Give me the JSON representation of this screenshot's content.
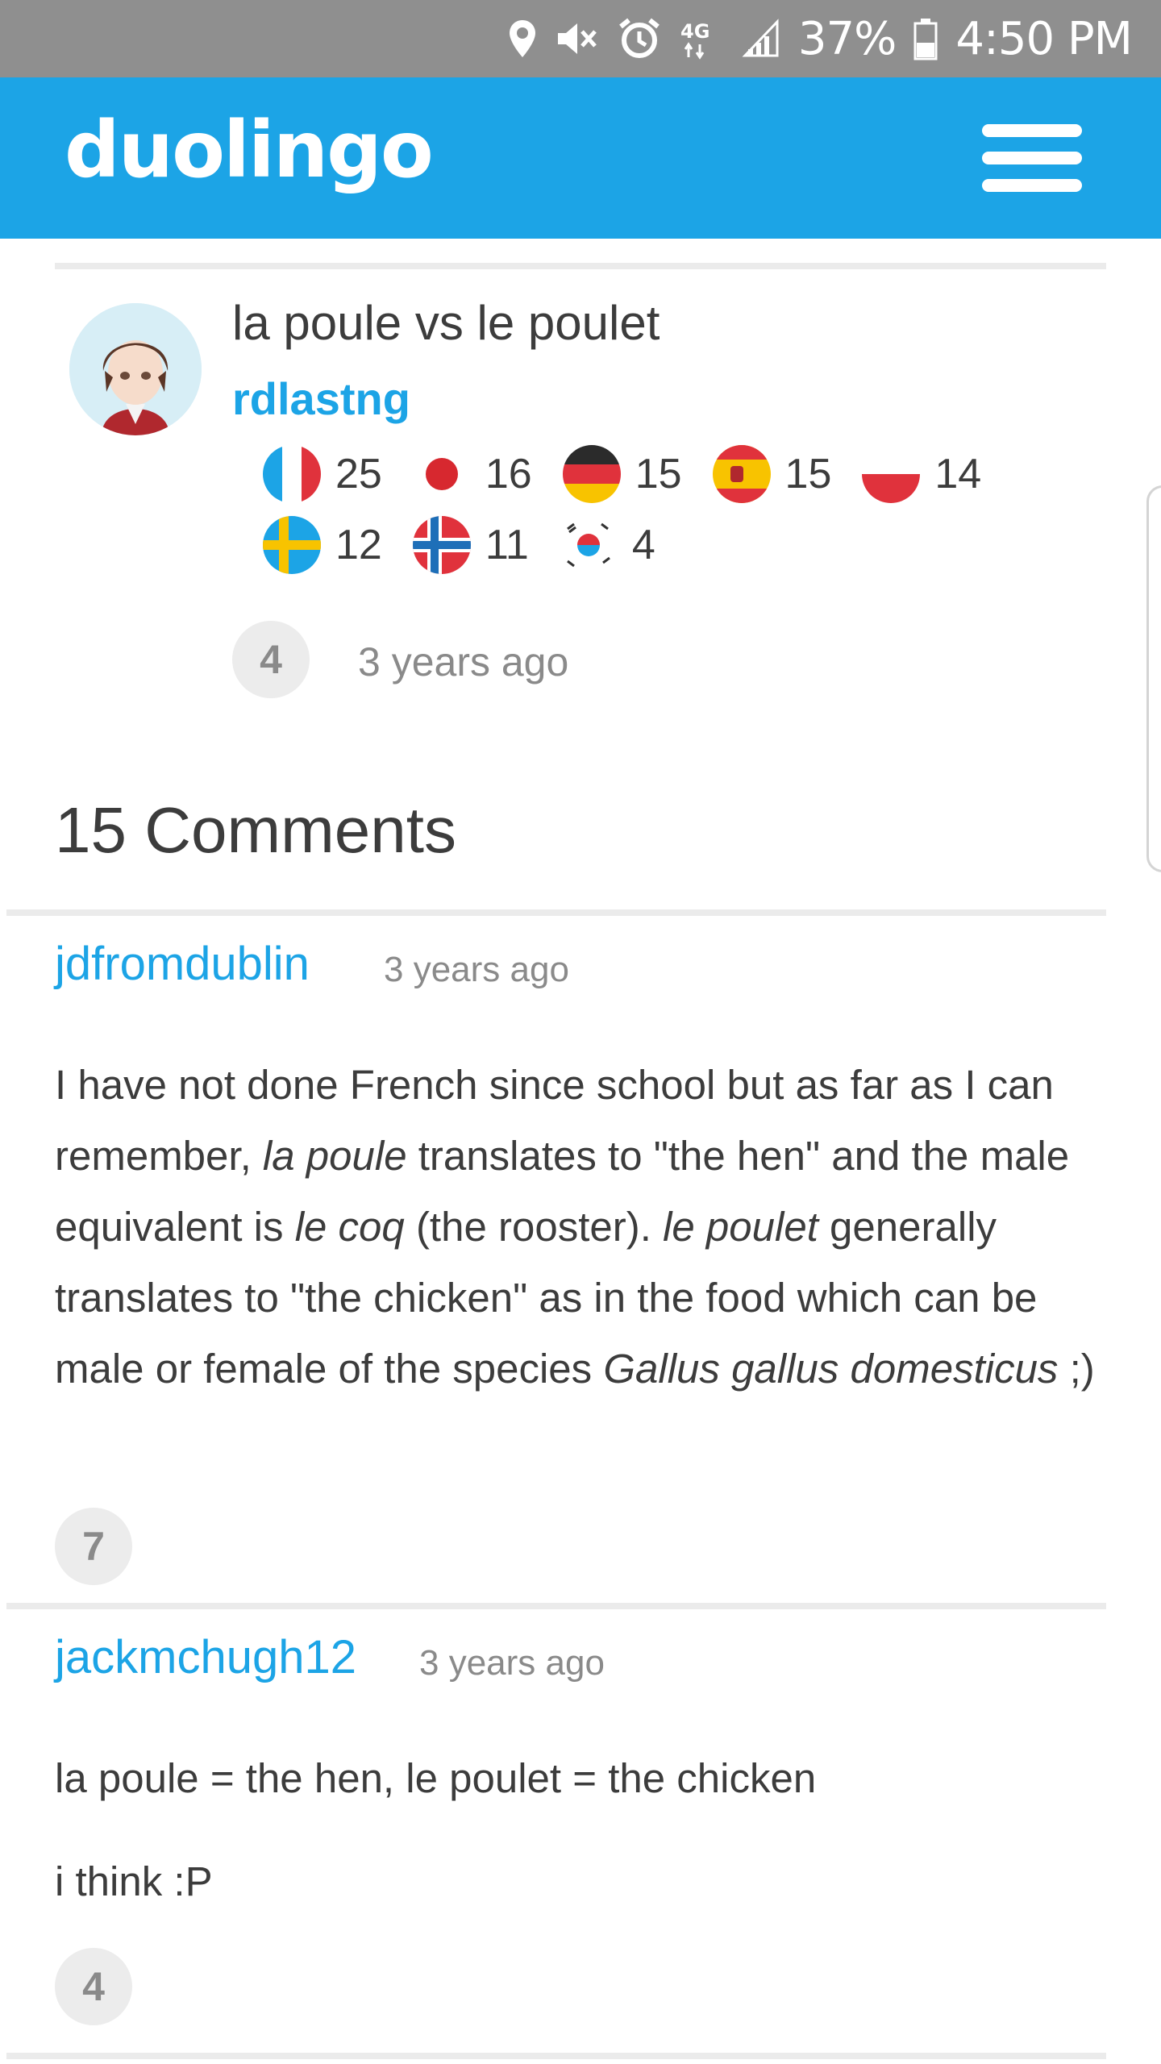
{
  "status_bar": {
    "battery": "37%",
    "time": "4:50 PM",
    "network": "4G"
  },
  "header": {
    "logo": "duolingo",
    "menu_icon": "hamburger-menu-icon"
  },
  "post": {
    "title": "la poule vs le poulet",
    "author": "rdlastng",
    "flags": [
      {
        "language": "French",
        "level": "25"
      },
      {
        "language": "Japanese",
        "level": "16"
      },
      {
        "language": "German",
        "level": "15"
      },
      {
        "language": "Spanish",
        "level": "15"
      },
      {
        "language": "Polish",
        "level": "14"
      },
      {
        "language": "Swedish",
        "level": "12"
      },
      {
        "language": "Norwegian",
        "level": "11"
      },
      {
        "language": "Korean",
        "level": "4"
      }
    ],
    "votes": "4",
    "timestamp": "3 years ago"
  },
  "comments_heading": "15 Comments",
  "comments": [
    {
      "user": "jdfromdublin",
      "time": "3 years ago",
      "body": {
        "p1": "I have not done French since school but as far as I can remember, ",
        "i1": "la poule",
        "p2": " translates to \"the hen\" and the male equivalent is ",
        "i2": "le coq",
        "p3": " (the rooster). ",
        "i3": "le poulet",
        "p4": " generally translates to \"the chicken\" as in the food which can be male or female of the species ",
        "i4": "Gallus gallus domesticus",
        "p5": " ;)"
      },
      "votes": "7"
    },
    {
      "user": "jackmchugh12",
      "time": "3 years ago",
      "body_lines": [
        "la poule = the hen, le poulet = the chicken",
        "i think :P"
      ],
      "votes": "4"
    }
  ],
  "colors": {
    "brand": "#1ca4e6",
    "status_bar": "#8f8f8f",
    "text": "#3c3c3c",
    "muted": "#8a8a8a"
  }
}
